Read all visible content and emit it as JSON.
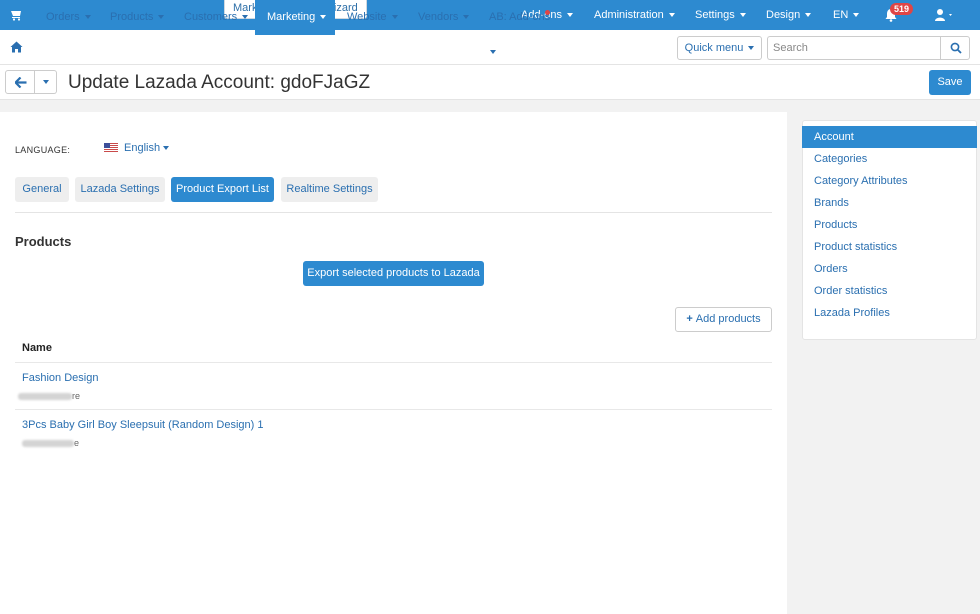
{
  "topbar": {
    "wizard": "Marketplace setup wizard",
    "menu": [
      {
        "label": "Add-ons"
      },
      {
        "label": "Administration"
      },
      {
        "label": "Settings"
      },
      {
        "label": "Design"
      },
      {
        "label": "EN"
      }
    ],
    "notifications_count": "519"
  },
  "nav": {
    "items": [
      {
        "label": "Orders"
      },
      {
        "label": "Products"
      },
      {
        "label": "Customers"
      },
      {
        "label": "Marketing"
      },
      {
        "label": "Website"
      },
      {
        "label": "Vendors"
      },
      {
        "label": "AB: Add-ons"
      }
    ],
    "active": "Marketing",
    "quick_menu": "Quick menu",
    "search_placeholder": "Search"
  },
  "titlebar": {
    "title": "Update Lazada Account: gdoFJaGZ",
    "save": "Save"
  },
  "main": {
    "language_label": "LANGUAGE:",
    "language_value": "English",
    "tabs": [
      {
        "label": "General"
      },
      {
        "label": "Lazada Settings"
      },
      {
        "label": "Product Export List"
      },
      {
        "label": "Realtime Settings"
      }
    ],
    "active_tab": "Product Export List",
    "section_title": "Products",
    "export_button": "Export selected products to Lazada",
    "add_button": "Add products",
    "column_name": "Name",
    "products": [
      {
        "name": "Fashion Design",
        "sub_tail": "re"
      },
      {
        "name": "3Pcs Baby Girl Boy Sleepsuit (Random Design) 1",
        "sub_tail": "e"
      }
    ]
  },
  "sidebar": {
    "items": [
      {
        "label": "Account"
      },
      {
        "label": "Categories"
      },
      {
        "label": "Category Attributes"
      },
      {
        "label": "Brands"
      },
      {
        "label": "Products"
      },
      {
        "label": "Product statistics"
      },
      {
        "label": "Orders"
      },
      {
        "label": "Order statistics"
      },
      {
        "label": "Lazada Profiles"
      }
    ],
    "active": "Account"
  },
  "colors": {
    "accent": "#2d8ad0",
    "link": "#2a6fb0",
    "badge": "#e04545"
  }
}
